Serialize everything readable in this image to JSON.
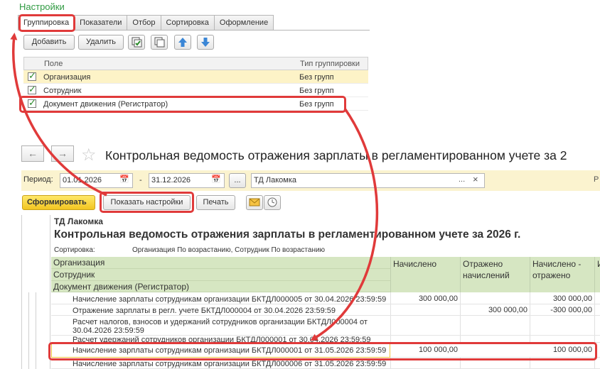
{
  "settings": {
    "title": "Настройки",
    "tabs": [
      "Группировка",
      "Показатели",
      "Отбор",
      "Сортировка",
      "Оформление"
    ],
    "toolbar": {
      "add_label": "Добавить",
      "delete_label": "Удалить"
    },
    "grid": {
      "columns": [
        "Поле",
        "Тип группировки"
      ],
      "rows": [
        {
          "checked": true,
          "field": "Организация",
          "type": "Без групп"
        },
        {
          "checked": true,
          "field": "Сотрудник",
          "type": "Без групп"
        },
        {
          "checked": true,
          "field": "Документ движения (Регистратор)",
          "type": "Без групп"
        }
      ]
    }
  },
  "form": {
    "title": "Контрольная ведомость отражения зарплаты в регламентированном учете  за 2",
    "period_label": "Период:",
    "date_from": "01.01.2026",
    "date_sep": "-",
    "date_to": "31.12.2026",
    "dots": "...",
    "org_value": "ТД Лакомка",
    "org_dots": "...",
    "org_clear": "×",
    "cut_label": "Р",
    "buttons": {
      "generate": "Сформировать",
      "show_settings": "Показать настройки",
      "print": "Печать"
    }
  },
  "report": {
    "org": "ТД Лакомка",
    "title": "Контрольная ведомость отражения зарплаты в регламентированном учете  за 2026 г.",
    "sort_label": "Сортировка:",
    "sort_value": "Организация По возрастанию, Сотрудник По возрастанию",
    "group_headers": [
      "Организация",
      "Сотрудник",
      "Документ движения (Регистратор)"
    ],
    "columns": [
      "Начислено",
      "Отражено начислений",
      "Начислено - отражено",
      "И"
    ],
    "rows": [
      {
        "doc": "Начисление зарплаты сотрудникам организации БКТДЛ000005 от 30.04.2026 23:59:59",
        "accrued": "300 000,00",
        "reflected": "",
        "diff": "300 000,00"
      },
      {
        "doc": "Отражение зарплаты в регл. учете БКТДЛ000004 от 30.04.2026 23:59:59",
        "accrued": "",
        "reflected": "300 000,00",
        "diff": "-300 000,00"
      },
      {
        "doc": "Расчет налогов, взносов и удержаний сотрудников организации БКТДЛ000004 от",
        "doc2": "30.04.2026 23:59:59",
        "accrued": "",
        "reflected": "",
        "diff": ""
      },
      {
        "doc": "Расчет удержаний сотрудников организации БКТДЛ000001 от 30.04.2026 23:59:59",
        "accrued": "",
        "reflected": "",
        "diff": ""
      },
      {
        "doc": "Начисление зарплаты сотрудникам организации БКТДЛ000001 от 31.05.2026 23:59:59",
        "accrued": "100 000,00",
        "reflected": "",
        "diff": "100 000,00"
      },
      {
        "doc": "Начисление зарплаты сотрудникам организации БКТДЛ000006 от 31.05.2026 23:59:59",
        "accrued": "",
        "reflected": "",
        "diff": ""
      }
    ]
  },
  "colors": {
    "callout": "#e03a3a",
    "green_header": "#d6e6c2",
    "period_bar": "#fbf3cf",
    "settings_title": "#2f9a41"
  }
}
